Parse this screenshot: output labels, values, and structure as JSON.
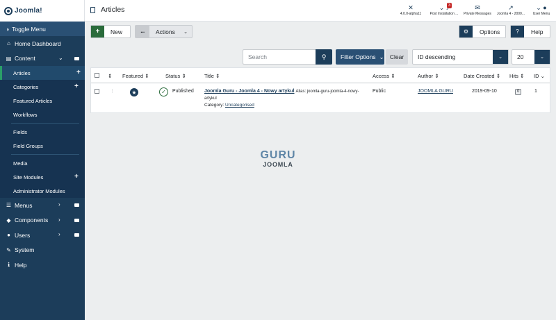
{
  "brand": {
    "logo_text": "Joomla!"
  },
  "header": {
    "title": "Articles",
    "items": [
      {
        "label": "4.0.0-alpha11",
        "icon": "joomla-icon"
      },
      {
        "label": "Post Installation ...",
        "icon": "bell-icon",
        "badge": "3"
      },
      {
        "label": "Private Messages",
        "icon": "envelope-icon"
      },
      {
        "label": "Joomla 4 - 2000...",
        "icon": "external-link-icon"
      },
      {
        "label": "User Menu",
        "icon": "user-icon"
      }
    ]
  },
  "sidebar": {
    "toggle_label": "Toggle Menu",
    "home_label": "Home Dashboard",
    "content_label": "Content",
    "content_items": [
      "Articles",
      "Categories",
      "Featured Articles",
      "Workflows",
      "Fields",
      "Field Groups",
      "Media",
      "Site Modules",
      "Administrator Modules"
    ],
    "menus_label": "Menus",
    "components_label": "Components",
    "users_label": "Users",
    "system_label": "System",
    "help_label": "Help"
  },
  "toolbar": {
    "new_label": "New",
    "actions_label": "Actions",
    "options_label": "Options",
    "help_label": "Help"
  },
  "filters": {
    "search_placeholder": "Search",
    "filter_options_label": "Filter Options",
    "clear_label": "Clear",
    "sort_value": "ID descending",
    "limit_value": "20"
  },
  "table": {
    "columns": [
      "Featured",
      "Status",
      "Title",
      "Access",
      "Author",
      "Date Created",
      "Hits",
      "ID"
    ],
    "rows": [
      {
        "status": "Published",
        "title": "Joomla Guru - Joomla 4 - Nowy artykul",
        "alias": "Alias: joomla-guru-joomla-4-nowy-artykul",
        "category_label": "Category:",
        "category": "Uncategorised",
        "access": "Public",
        "author": "JOOMLA GURU",
        "date": "2019-09-10",
        "hits": "0",
        "id": "1"
      }
    ]
  },
  "watermark": {
    "line1": "GURU",
    "line2": "JOOMLA"
  }
}
